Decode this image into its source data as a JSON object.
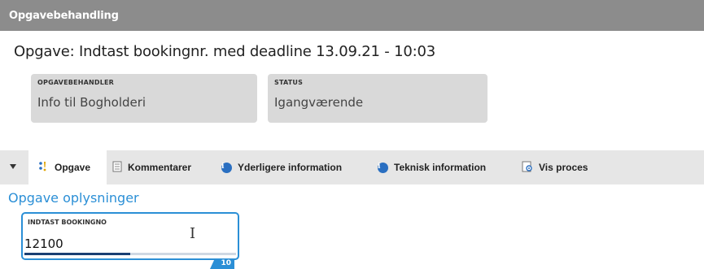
{
  "header": {
    "title": "Opgavebehandling"
  },
  "task": {
    "title": "Opgave: Indtast bookingnr. med deadline 13.09.21 - 10:03"
  },
  "cards": {
    "handler": {
      "caption": "OPGAVEBEHANDLER",
      "value": "Info til Bogholderi"
    },
    "status": {
      "caption": "STATUS",
      "value": "Igangværende"
    }
  },
  "tabs": {
    "opgave": {
      "label": "Opgave",
      "icon": "task-icon"
    },
    "kommentarer": {
      "label": "Kommentarer",
      "icon": "document-icon"
    },
    "yderligere": {
      "label": "Yderligere information",
      "icon": "info-icon"
    },
    "teknisk": {
      "label": "Teknisk information",
      "icon": "info-icon"
    },
    "vis_proces": {
      "label": "Vis proces",
      "icon": "process-icon"
    }
  },
  "section": {
    "title": "Opgave oplysninger"
  },
  "booking_field": {
    "caption": "INDTAST BOOKINGNO",
    "value": "12100",
    "counter": "10",
    "progress_fraction": 0.5
  },
  "colors": {
    "accent": "#2b8fd6",
    "header_bg": "#8c8c8c",
    "info_icon": "#2a6fc1"
  }
}
